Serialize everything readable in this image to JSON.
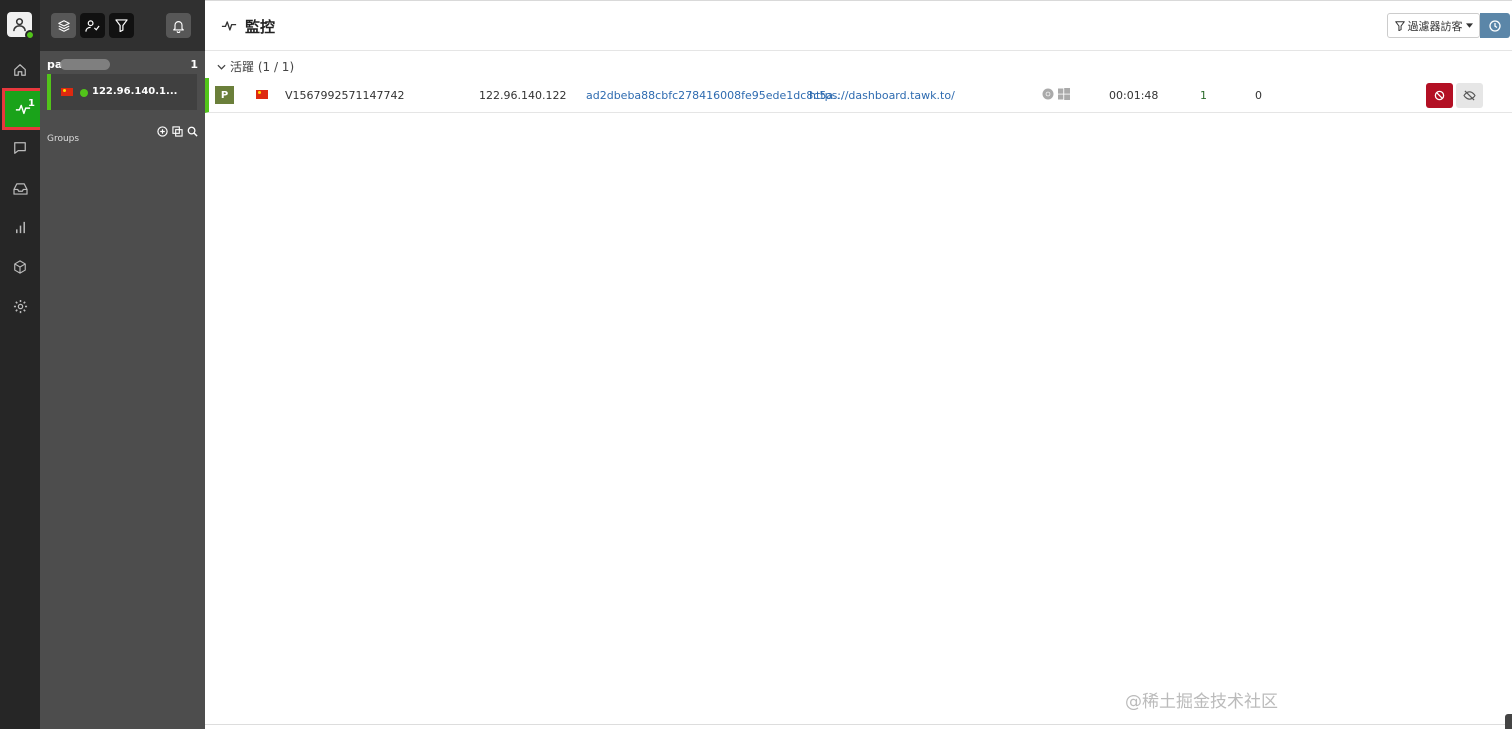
{
  "rail": {
    "monitor_badge": "1",
    "nav_items": [
      "home",
      "monitoring",
      "chat",
      "inbox",
      "reports",
      "addons",
      "settings"
    ]
  },
  "panel": {
    "section_name": "pa",
    "section_count": "1",
    "visitor_ip": "122.96.140.1...",
    "groups_label": "Groups"
  },
  "main": {
    "title": "監控",
    "filter_label": "過濾器訪客",
    "group_label": "活躍 (1 / 1)",
    "visitors": [
      {
        "badge": "P",
        "id": "V1567992571147742",
        "ip": "122.96.140.122",
        "hash": "ad2dbeba88cbfc278416008fe95ede1dc8c5a...",
        "url": "https://dashboard.tawk.to/",
        "duration": "00:01:48",
        "chats": "1",
        "pages": "0"
      }
    ]
  },
  "watermark": "@稀土掘金技术社区",
  "colors": {
    "rail_bg": "#262626",
    "panel_bg": "#4d4d4d",
    "active_green": "#1aa31a",
    "online_green": "#52c41a",
    "ban_red": "#b31024",
    "link_blue": "#2e6bb0",
    "clock_blue": "#5b86a8"
  }
}
